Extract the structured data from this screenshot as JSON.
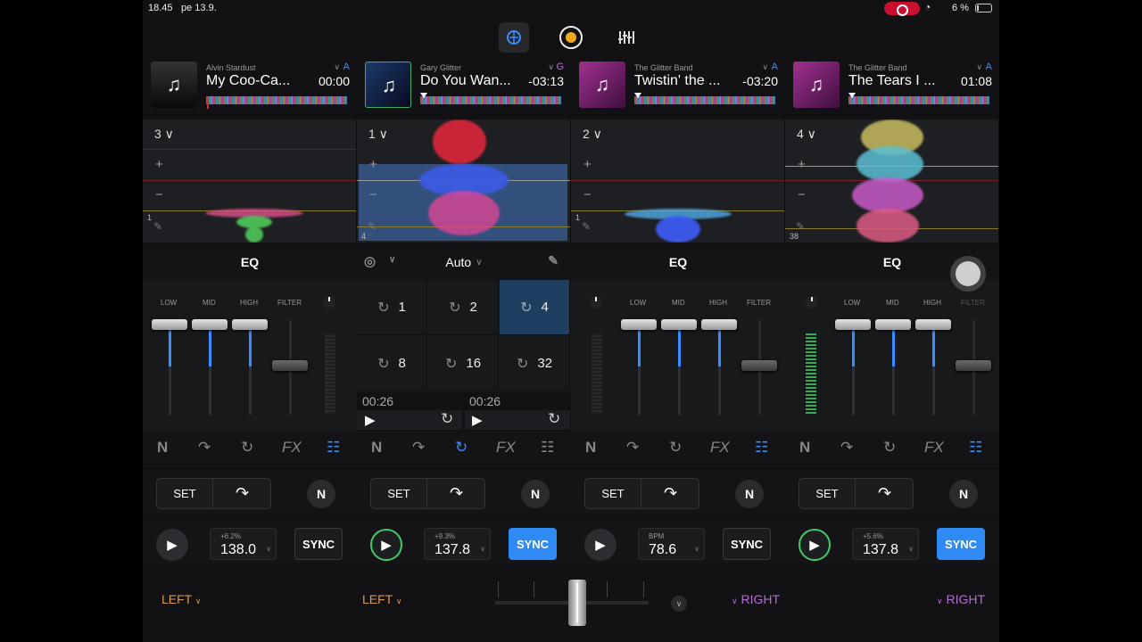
{
  "status": {
    "time": "18.45",
    "date": "pe 13.9.",
    "battery": "6 %"
  },
  "decks_top": [
    {
      "artist": "Alvin Stardust",
      "title": "My Coo-Ca...",
      "time": "00:00",
      "key": "A",
      "key_color": "#3a8dff"
    },
    {
      "artist": "Gary Glitter",
      "title": "Do You Wan...",
      "time": "-03:13",
      "key": "G",
      "key_color": "#b070d0"
    },
    {
      "artist": "The Glitter Band",
      "title": "Twistin' the ...",
      "time": "-03:20",
      "key": "A",
      "key_color": "#3a8dff"
    },
    {
      "artist": "The Glitter Band",
      "title": "The Tears I ...",
      "time": "01:08",
      "key": "A",
      "key_color": "#3a8dff"
    }
  ],
  "panels": [
    {
      "num": "3",
      "corner": "1"
    },
    {
      "num": "1",
      "corner": "4"
    },
    {
      "num": "2",
      "corner": "1"
    },
    {
      "num": "4",
      "corner": "38"
    }
  ],
  "sections": {
    "eq1": "EQ",
    "auto": "Auto",
    "eq3": "EQ",
    "eq4": "EQ"
  },
  "mixer_labels": {
    "low": "LOW",
    "mid": "MID",
    "high": "HIGH",
    "filter": "FILTER"
  },
  "loops": [
    "1",
    "2",
    "4",
    "8",
    "16",
    "32"
  ],
  "loop_times": [
    "00:26",
    "00:26"
  ],
  "fx_label": "FX",
  "set_label": "SET",
  "n_label": "N",
  "transport": [
    {
      "sub": "+6.2%",
      "bpm": "138.0",
      "sync": "SYNC",
      "sync_on": false,
      "playing": false
    },
    {
      "sub": "+9.3%",
      "bpm": "137.8",
      "sync": "SYNC",
      "sync_on": true,
      "playing": true
    },
    {
      "sub": "BPM",
      "bpm": "78.6",
      "sync": "SYNC",
      "sync_on": false,
      "playing": false
    },
    {
      "sub": "+5.6%",
      "bpm": "137.8",
      "sync": "SYNC",
      "sync_on": true,
      "playing": true
    }
  ],
  "bottom": {
    "a1": "LEFT",
    "a2": "LEFT",
    "a3": "RIGHT",
    "a4": "RIGHT"
  },
  "colors": {
    "accent": "#3a8dff",
    "play_on": "#47c86a",
    "left": "#d59a55",
    "right": "#b070d0"
  }
}
